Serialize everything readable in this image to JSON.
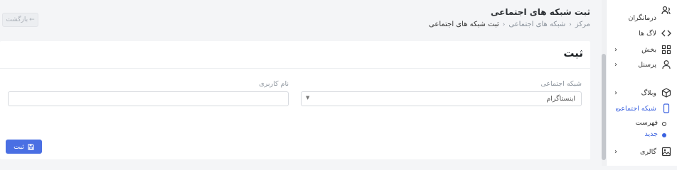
{
  "header": {
    "back_label": "بازگشت",
    "page_title": "ثبت شبکه های اجتماعی",
    "breadcrumb": [
      "مرکز",
      "شبکه های اجتماعی",
      "ثبت شبکه های اجتماعی"
    ]
  },
  "form": {
    "card_title": "ثبت",
    "social_label": "شبکه اجتماعی",
    "social_selected": "اینستاگرام",
    "username_label": "نام کاربری",
    "username_value": "",
    "submit_label": "ثبت"
  },
  "sidebar": {
    "items": [
      {
        "label": "درمانگران",
        "icon": "users-icon"
      },
      {
        "label": "لاگ ها",
        "icon": "code-icon"
      },
      {
        "label": "بخش",
        "icon": "grid-icon"
      },
      {
        "label": "پرسنل",
        "icon": "user-icon"
      },
      {
        "label": "وبلاگ",
        "icon": "box-icon"
      },
      {
        "label": "شبکه اجتماعی",
        "icon": "phone-icon"
      },
      {
        "label": "گالری",
        "icon": "image-icon"
      }
    ],
    "subitems": [
      {
        "label": "فهرست"
      },
      {
        "label": "جدید"
      }
    ]
  },
  "colors": {
    "accent": "#3b62e0",
    "button": "#4a6fe3"
  }
}
